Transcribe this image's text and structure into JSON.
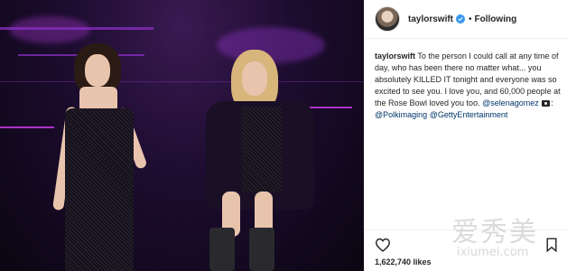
{
  "post": {
    "username": "taylorswift",
    "follow_status": "Following",
    "separator": "•",
    "caption": {
      "author": "taylorswift",
      "text": "To the person I could call at any time of day, who has been there no matter what... you absolutely KILLED IT tonight and everyone was so excited to see you. I love you, and 60,000 people at the Rose Bowl loved you too.",
      "mention1": "@selenagomez",
      "mention2": "@Polkimaging",
      "mention3": "@GettyEntertainment"
    },
    "likes": "1,622,740 likes"
  },
  "watermark": {
    "cn": "爱秀美",
    "url": "ixiumei.com"
  },
  "icons": {
    "verified": "verified-badge-icon",
    "camera": "camera-icon",
    "like": "heart-icon",
    "save": "bookmark-icon"
  },
  "colors": {
    "verified": "#3897f0",
    "mention": "#003569",
    "text": "#262626"
  }
}
